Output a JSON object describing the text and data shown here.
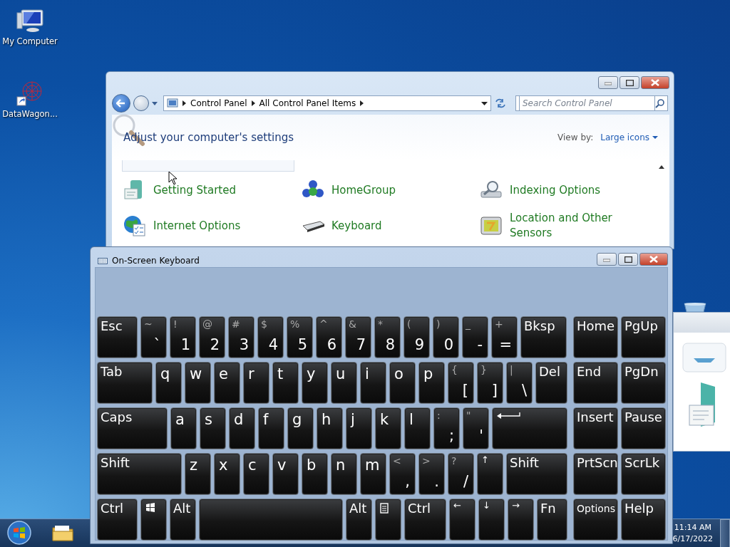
{
  "desktop": {
    "icons": [
      {
        "kind": "computer",
        "label": "My Computer"
      },
      {
        "kind": "shortcut",
        "label": "DataWagon..."
      }
    ]
  },
  "control_panel": {
    "breadcrumb": [
      "Control Panel",
      "All Control Panel Items"
    ],
    "search": {
      "placeholder": "Search Control Panel"
    },
    "heading": "Adjust your computer's settings",
    "view_by_label": "View by:",
    "view_by_value": "Large icons",
    "items": [
      {
        "kind": "getting-started",
        "label": "Getting Started"
      },
      {
        "kind": "homegroup",
        "label": "HomeGroup"
      },
      {
        "kind": "indexing",
        "label": "Indexing Options"
      },
      {
        "kind": "internet",
        "label": "Internet Options"
      },
      {
        "kind": "keyboard",
        "label": "Keyboard"
      },
      {
        "kind": "location",
        "label": "Location and Other Sensors"
      }
    ]
  },
  "keyboard": {
    "title": "On-Screen Keyboard",
    "main_rows": [
      [
        {
          "kind": "func",
          "label": "Esc"
        },
        {
          "kind": "char",
          "top": "~",
          "main": "`"
        },
        {
          "kind": "char",
          "top": "!",
          "main": "1"
        },
        {
          "kind": "char",
          "top": "@",
          "main": "2"
        },
        {
          "kind": "char",
          "top": "#",
          "main": "3"
        },
        {
          "kind": "char",
          "top": "$",
          "main": "4"
        },
        {
          "kind": "char",
          "top": "%",
          "main": "5"
        },
        {
          "kind": "char",
          "top": "^",
          "main": "6"
        },
        {
          "kind": "char",
          "top": "&",
          "main": "7"
        },
        {
          "kind": "char",
          "top": "*",
          "main": "8"
        },
        {
          "kind": "char",
          "top": "(",
          "main": "9"
        },
        {
          "kind": "char",
          "top": ")",
          "main": "0"
        },
        {
          "kind": "char",
          "top": "_",
          "main": "-"
        },
        {
          "kind": "char",
          "top": "+",
          "main": "="
        },
        {
          "kind": "func",
          "label": "Bksp"
        }
      ],
      [
        {
          "kind": "func",
          "label": "Tab"
        },
        {
          "kind": "letter",
          "main": "q"
        },
        {
          "kind": "letter",
          "main": "w"
        },
        {
          "kind": "letter",
          "main": "e"
        },
        {
          "kind": "letter",
          "main": "r"
        },
        {
          "kind": "letter",
          "main": "t"
        },
        {
          "kind": "letter",
          "main": "y"
        },
        {
          "kind": "letter",
          "main": "u"
        },
        {
          "kind": "letter",
          "main": "i"
        },
        {
          "kind": "letter",
          "main": "o"
        },
        {
          "kind": "letter",
          "main": "p"
        },
        {
          "kind": "char",
          "top": "{",
          "main": "["
        },
        {
          "kind": "char",
          "top": "}",
          "main": "]"
        },
        {
          "kind": "char",
          "top": "|",
          "main": "\\"
        },
        {
          "kind": "func",
          "label": "Del"
        }
      ],
      [
        {
          "kind": "func",
          "label": "Caps"
        },
        {
          "kind": "letter",
          "main": "a"
        },
        {
          "kind": "letter",
          "main": "s"
        },
        {
          "kind": "letter",
          "main": "d"
        },
        {
          "kind": "letter",
          "main": "f"
        },
        {
          "kind": "letter",
          "main": "g"
        },
        {
          "kind": "letter",
          "main": "h"
        },
        {
          "kind": "letter",
          "main": "j"
        },
        {
          "kind": "letter",
          "main": "k"
        },
        {
          "kind": "letter",
          "main": "l"
        },
        {
          "kind": "char",
          "top": ":",
          "main": ";"
        },
        {
          "kind": "char",
          "top": "\"",
          "main": "'"
        },
        {
          "kind": "enter"
        }
      ],
      [
        {
          "kind": "func",
          "label": "Shift"
        },
        {
          "kind": "letter",
          "main": "z"
        },
        {
          "kind": "letter",
          "main": "x"
        },
        {
          "kind": "letter",
          "main": "c"
        },
        {
          "kind": "letter",
          "main": "v"
        },
        {
          "kind": "letter",
          "main": "b"
        },
        {
          "kind": "letter",
          "main": "n"
        },
        {
          "kind": "letter",
          "main": "m"
        },
        {
          "kind": "char",
          "top": "<",
          "main": ","
        },
        {
          "kind": "char",
          "top": ">",
          "main": "."
        },
        {
          "kind": "char",
          "top": "?",
          "main": "/"
        },
        {
          "kind": "small",
          "label": "↑"
        },
        {
          "kind": "func",
          "label": "Shift"
        }
      ],
      [
        {
          "kind": "func",
          "label": "Ctrl"
        },
        {
          "kind": "win"
        },
        {
          "kind": "func",
          "label": "Alt"
        },
        {
          "kind": "space"
        },
        {
          "kind": "func",
          "label": "Alt"
        },
        {
          "kind": "menu"
        },
        {
          "kind": "func",
          "label": "Ctrl"
        },
        {
          "kind": "small",
          "label": "←"
        },
        {
          "kind": "small",
          "label": "↓"
        },
        {
          "kind": "small",
          "label": "→"
        },
        {
          "kind": "func",
          "label": "Fn"
        }
      ]
    ],
    "nav_rows": [
      [
        {
          "kind": "func",
          "label": "Home"
        },
        {
          "kind": "func",
          "label": "PgUp"
        }
      ],
      [
        {
          "kind": "func",
          "label": "End"
        },
        {
          "kind": "func",
          "label": "PgDn"
        }
      ],
      [
        {
          "kind": "func",
          "label": "Insert"
        },
        {
          "kind": "func",
          "label": "Pause"
        }
      ],
      [
        {
          "kind": "func",
          "label": "PrtScn"
        },
        {
          "kind": "func",
          "label": "ScrLk"
        }
      ],
      [
        {
          "kind": "smallfunc",
          "label": "Options"
        },
        {
          "kind": "func",
          "label": "Help"
        }
      ]
    ]
  },
  "taskbar": {
    "time": "11:14 AM",
    "date": "6/17/2022"
  }
}
